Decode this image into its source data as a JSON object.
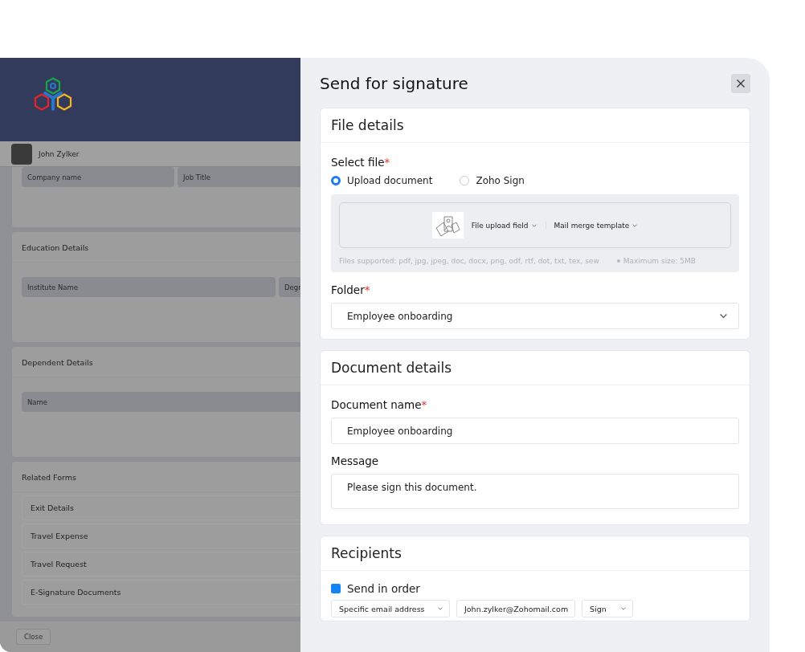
{
  "app": {
    "user": {
      "name": "John Zylker"
    },
    "sections": [
      {
        "kind": "fields",
        "fields": [
          "Company name",
          "Job Title"
        ]
      },
      {
        "kind": "fields",
        "title": "Education Details",
        "fields": [
          "Institute Name",
          "Degr"
        ]
      },
      {
        "kind": "fields",
        "title": "Dependent Details",
        "fields": [
          "Name"
        ]
      },
      {
        "kind": "links",
        "title": "Related Forms",
        "items": [
          "Exit Details",
          "Travel Expense",
          "Travel Request",
          "E-Signature Documents"
        ]
      }
    ],
    "footer": {
      "button": "Close"
    }
  },
  "dialog": {
    "title": "Send for signature",
    "file_details": {
      "title": "File details",
      "select_label": "Select file",
      "select_mark": "*",
      "options": [
        {
          "label": "Upload document",
          "selected": true
        },
        {
          "label": "Zoho Sign",
          "selected": false
        }
      ],
      "upload": {
        "menus": [
          "File upload field",
          "Mail merge template"
        ],
        "supported": "Files supported: pdf, jpg, jpeg, doc, docx, png, odf,  rtf, dot, txt, tex, sew",
        "max_size": "Maximum size: 5MB"
      },
      "folder_label": "Folder",
      "folder_mark": "*",
      "folder_value": "Employee onboarding"
    },
    "document_details": {
      "title": "Document details",
      "name_label": "Document name",
      "name_mark": "*",
      "name_value": "Employee onboarding",
      "message_label": "Message",
      "message_value": "Please sign this document."
    },
    "recipients": {
      "title": "Recipients",
      "send_in_order": {
        "label": "Send in order",
        "checked": true
      },
      "row": {
        "type": "Specific email address",
        "email": "John.zylker@Zohomail.com",
        "action": "Sign"
      }
    }
  }
}
